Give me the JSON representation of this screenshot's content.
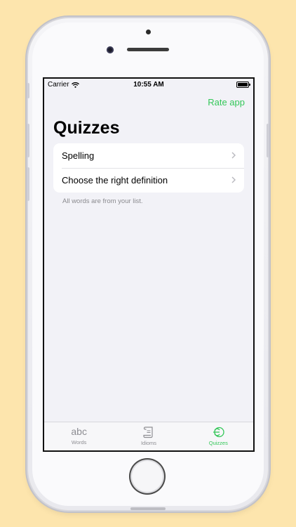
{
  "status_bar": {
    "carrier": "Carrier",
    "time": "10:55 AM"
  },
  "nav": {
    "rate_label": "Rate app"
  },
  "page": {
    "title": "Quizzes"
  },
  "quizzes": {
    "items": [
      {
        "label": "Spelling"
      },
      {
        "label": "Choose the right definition"
      }
    ],
    "footer": "All words are from your list."
  },
  "tabbar": {
    "tabs": [
      {
        "label": "Words",
        "icon": "abc-icon",
        "glyph": "abc"
      },
      {
        "label": "Idioms",
        "icon": "scroll-icon"
      },
      {
        "label": "Quizzes",
        "icon": "quiz-icon",
        "active": true
      }
    ]
  },
  "colors": {
    "accent": "#34c759",
    "background": "#fde5ad",
    "screen_bg": "#f2f2f7"
  }
}
